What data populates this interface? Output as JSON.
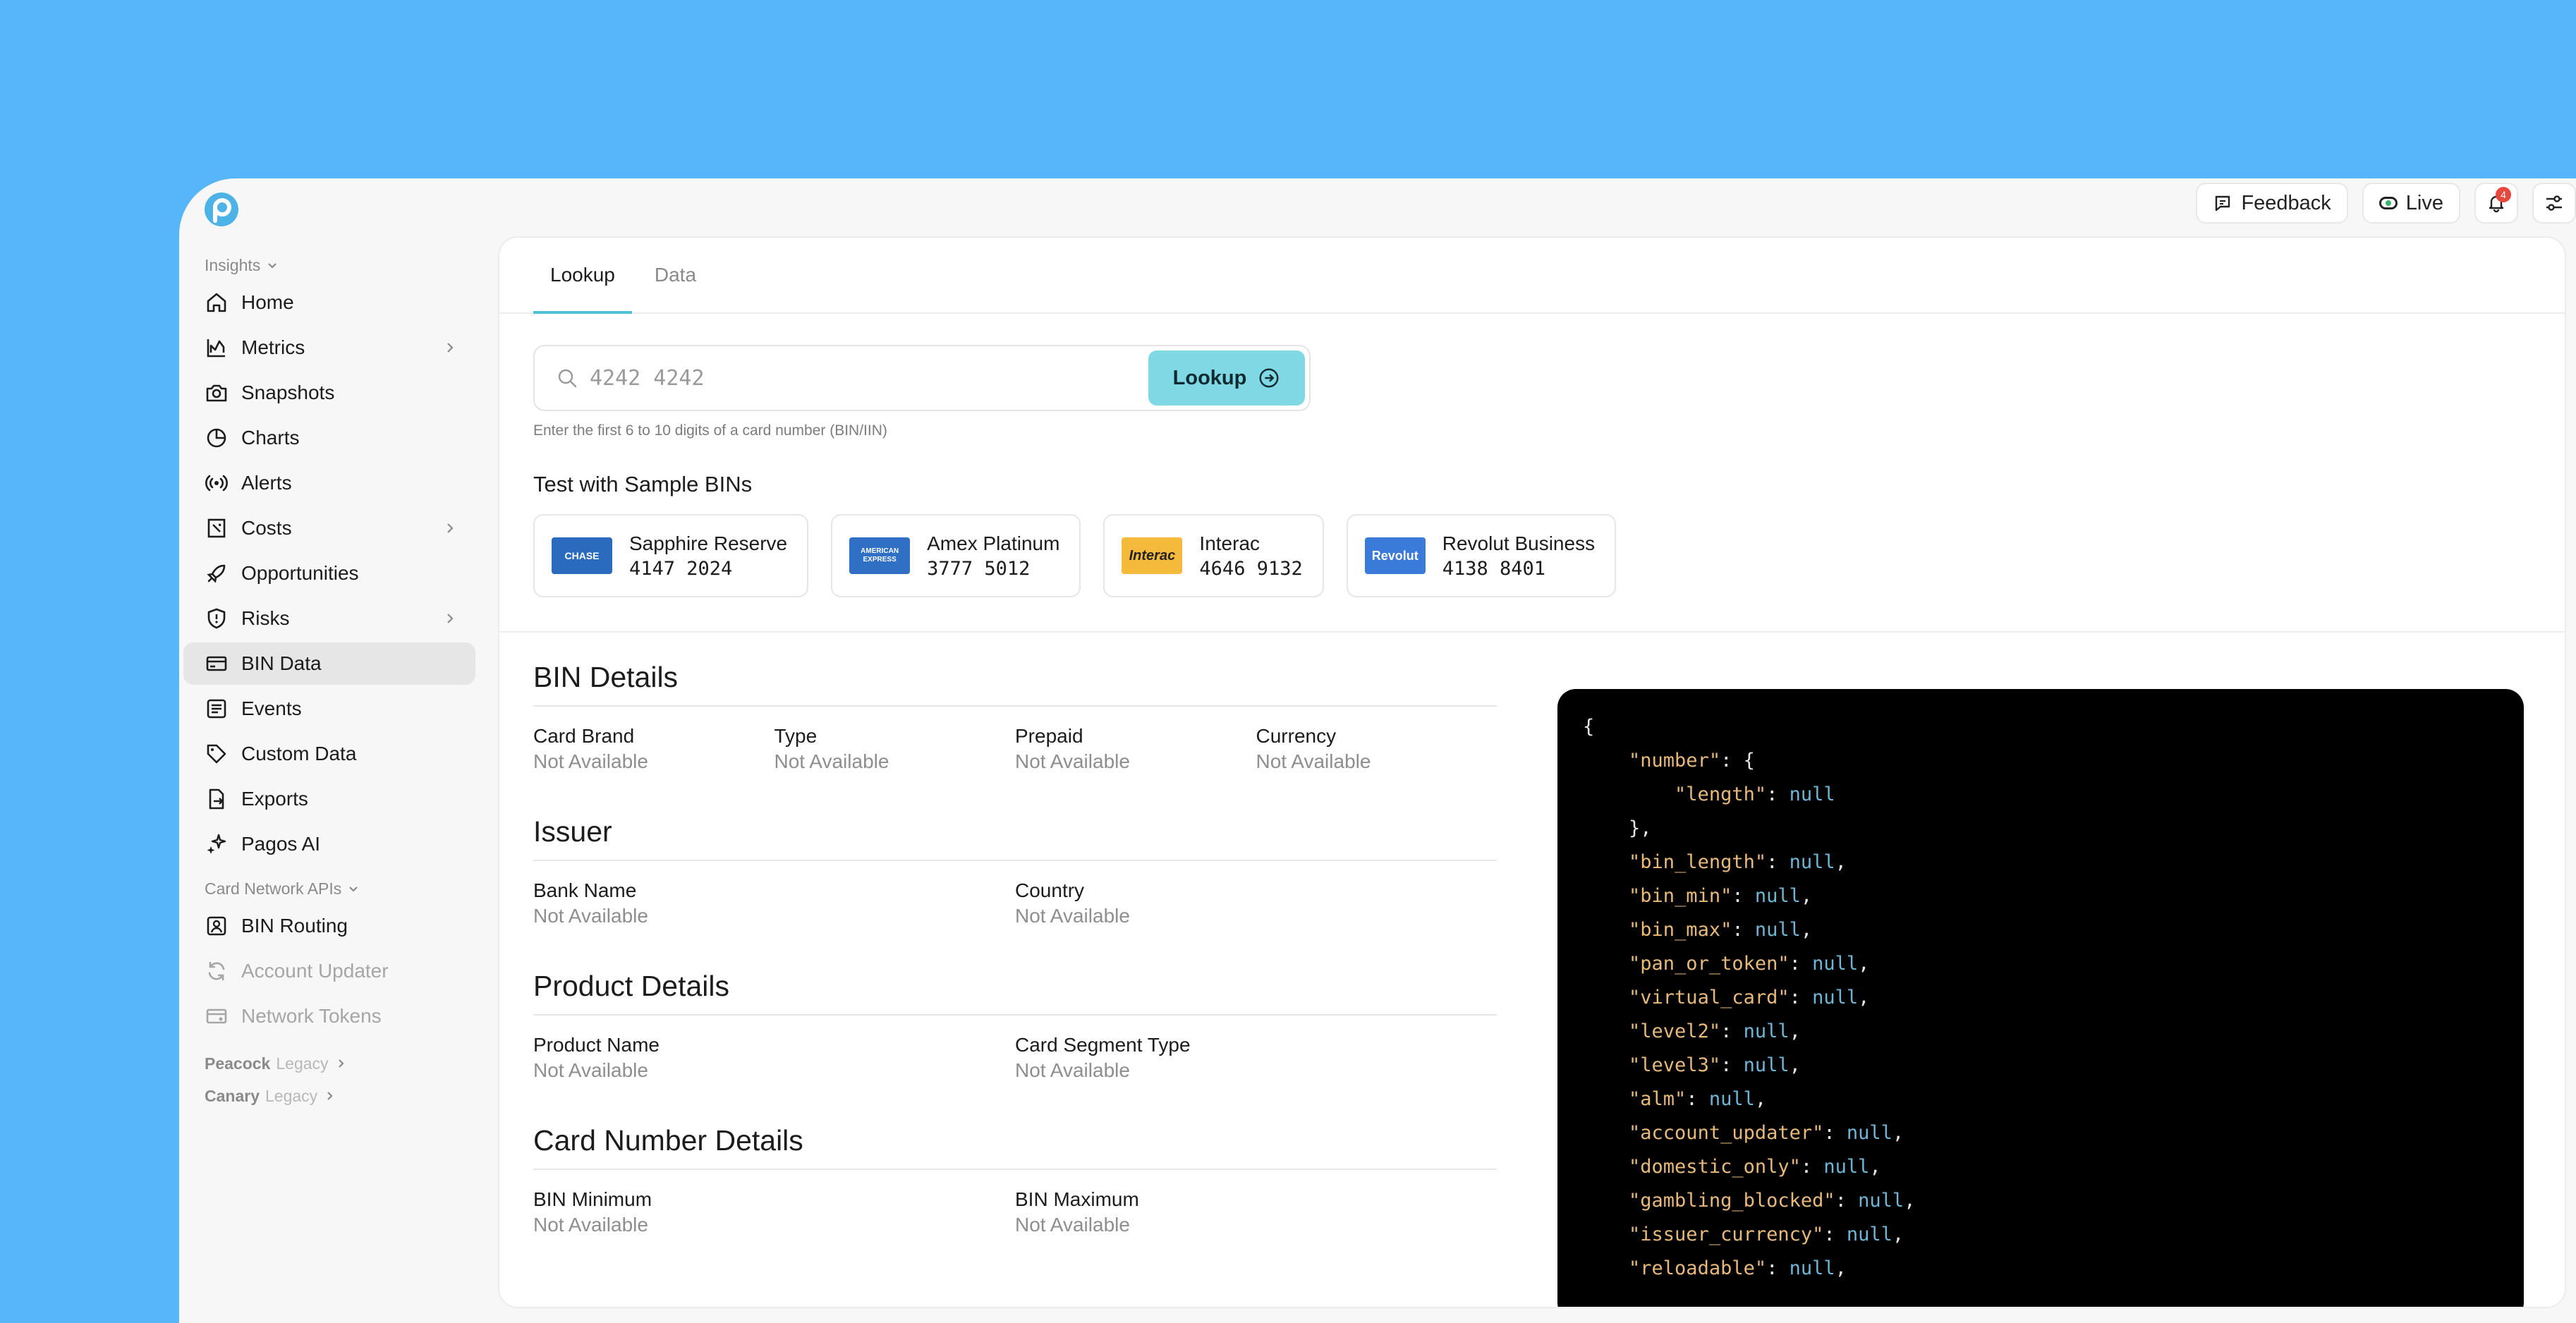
{
  "topbar": {
    "feedback_label": "Feedback",
    "live_label": "Live",
    "notification_count": "4"
  },
  "sidebar": {
    "section_insights": "Insights",
    "items": [
      {
        "label": "Home",
        "icon": "home-icon"
      },
      {
        "label": "Metrics",
        "icon": "metrics-icon",
        "has_children": true
      },
      {
        "label": "Snapshots",
        "icon": "camera-icon"
      },
      {
        "label": "Charts",
        "icon": "pie-chart-icon"
      },
      {
        "label": "Alerts",
        "icon": "broadcast-icon"
      },
      {
        "label": "Costs",
        "icon": "receipt-icon",
        "has_children": true
      },
      {
        "label": "Opportunities",
        "icon": "rocket-icon"
      },
      {
        "label": "Risks",
        "icon": "shield-icon",
        "has_children": true
      },
      {
        "label": "BIN Data",
        "icon": "card-icon",
        "active": true
      },
      {
        "label": "Events",
        "icon": "list-icon"
      },
      {
        "label": "Custom Data",
        "icon": "tag-icon"
      },
      {
        "label": "Exports",
        "icon": "file-export-icon"
      },
      {
        "label": "Pagos AI",
        "icon": "sparkle-icon"
      }
    ],
    "section_card_network": "Card Network APIs",
    "network_items": [
      {
        "label": "BIN Routing",
        "icon": "routing-icon"
      },
      {
        "label": "Account Updater",
        "icon": "refresh-icon",
        "disabled": true
      },
      {
        "label": "Network Tokens",
        "icon": "token-icon",
        "disabled": true
      }
    ],
    "peacock": {
      "name": "Peacock",
      "tag": "Legacy"
    },
    "canary": {
      "name": "Canary",
      "tag": "Legacy"
    }
  },
  "tabs": [
    "Lookup",
    "Data"
  ],
  "search": {
    "placeholder": "4242 4242",
    "button_label": "Lookup",
    "hint": "Enter the first 6 to 10 digits of a card number (BIN/IIN)"
  },
  "samples_title": "Test with Sample BINs",
  "samples": [
    {
      "name": "Sapphire Reserve",
      "bin": "4147 2024",
      "logo_text": "CHASE",
      "logo_color": "#2a6bbd"
    },
    {
      "name": "Amex Platinum",
      "bin": "3777 5012",
      "logo_text": "AMERICAN EXPRESS",
      "logo_color": "#2f6fc4"
    },
    {
      "name": "Interac",
      "bin": "4646 9132",
      "logo_text": "Interac",
      "logo_color": "#f5b93c"
    },
    {
      "name": "Revolut Business",
      "bin": "4138 8401",
      "logo_text": "Revolut",
      "logo_color": "#3a7ad9"
    }
  ],
  "sections": {
    "bin_details": {
      "title": "BIN Details",
      "fields": [
        {
          "label": "Card Brand",
          "value": "Not Available"
        },
        {
          "label": "Type",
          "value": "Not Available"
        },
        {
          "label": "Prepaid",
          "value": "Not Available"
        },
        {
          "label": "Currency",
          "value": "Not Available"
        }
      ]
    },
    "issuer": {
      "title": "Issuer",
      "fields": [
        {
          "label": "Bank Name",
          "value": "Not Available"
        },
        {
          "label": "Country",
          "value": "Not Available"
        }
      ]
    },
    "product_details": {
      "title": "Product Details",
      "fields": [
        {
          "label": "Product Name",
          "value": "Not Available"
        },
        {
          "label": "Card Segment Type",
          "value": "Not Available"
        }
      ]
    },
    "card_number_details": {
      "title": "Card Number Details",
      "fields": [
        {
          "label": "BIN Minimum",
          "value": "Not Available"
        },
        {
          "label": "BIN Maximum",
          "value": "Not Available"
        }
      ]
    }
  },
  "json_response": {
    "open_brace": "{",
    "number_key": "\"number\"",
    "length_key": "\"length\"",
    "null_value": "null",
    "keys": [
      "\"bin_length\"",
      "\"bin_min\"",
      "\"bin_max\"",
      "\"pan_or_token\"",
      "\"virtual_card\"",
      "\"level2\"",
      "\"level3\"",
      "\"alm\"",
      "\"account_updater\"",
      "\"domestic_only\"",
      "\"gambling_blocked\"",
      "\"issuer_currency\"",
      "\"reloadable\""
    ]
  },
  "colors": {
    "background": "#57b6f9",
    "accent": "#7fd8e3",
    "tab_underline": "#4fc3d6",
    "logo": "#4db3e6"
  }
}
